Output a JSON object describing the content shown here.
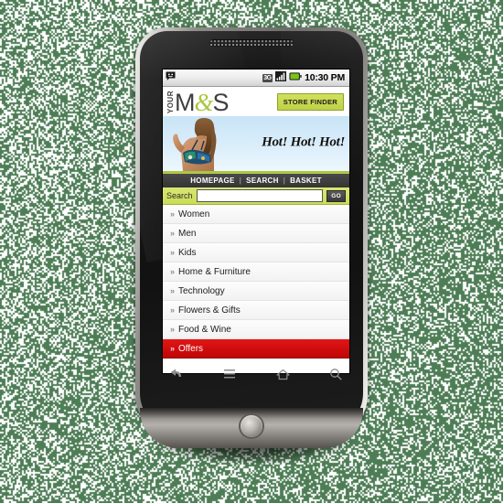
{
  "background": {
    "color": "#4d7d55",
    "pattern": "dithered-noise"
  },
  "device": {
    "name": "android-smartphone",
    "shell_color": "#8e8c88",
    "face_color": "#141414",
    "softkeys": [
      {
        "name": "back-softkey",
        "icon": "back-arrow-icon"
      },
      {
        "name": "menu-softkey",
        "icon": "hamburger-menu-icon"
      },
      {
        "name": "home-softkey",
        "icon": "home-icon"
      },
      {
        "name": "search-softkey",
        "icon": "search-icon"
      }
    ],
    "trackball": {
      "name": "trackball-button"
    }
  },
  "statusbar": {
    "notification_icon": "message-smiley-icon",
    "network": "3G",
    "signal_icon": "signal-bars-icon",
    "battery_icon": "battery-icon",
    "battery_color": "#7ac514",
    "clock": "10:30 PM"
  },
  "header": {
    "logo_prefix": "YOUR",
    "logo_m": "M",
    "logo_amp": "&",
    "logo_s": "S",
    "logo_accent": "#a9c63f",
    "store_finder_label": "STORE FINDER",
    "store_finder_color": "#c8d94a"
  },
  "hero": {
    "headline": "Hot! Hot! Hot!",
    "sky_color": "#d4e9f7",
    "alt": "model in bikini"
  },
  "nav": {
    "items": [
      {
        "label": "HOMEPAGE",
        "name": "nav-homepage"
      },
      {
        "label": "SEARCH",
        "name": "nav-search"
      },
      {
        "label": "BASKET",
        "name": "nav-basket"
      }
    ],
    "separator": "|",
    "bar_color": "#3a3a3a"
  },
  "search": {
    "label": "Search",
    "value": "",
    "placeholder": "",
    "go_label": "GO",
    "bar_color": "#cbdc58"
  },
  "menu": {
    "items": [
      {
        "label": "Women",
        "chevron": "»",
        "active": false
      },
      {
        "label": "Men",
        "chevron": "»",
        "active": false
      },
      {
        "label": "Kids",
        "chevron": "»",
        "active": false
      },
      {
        "label": "Home & Furniture",
        "chevron": "»",
        "active": false
      },
      {
        "label": "Technology",
        "chevron": "»",
        "active": false
      },
      {
        "label": "Flowers & Gifts",
        "chevron": "»",
        "active": false
      },
      {
        "label": "Food & Wine",
        "chevron": "»",
        "active": false
      },
      {
        "label": "Offers",
        "chevron": "»",
        "active": true
      }
    ],
    "active_color": "#d21111"
  }
}
